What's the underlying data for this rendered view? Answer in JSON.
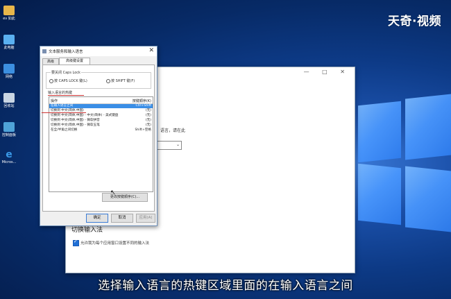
{
  "watermark": "天奇·视频",
  "caption": "选择输入语言的热键区域里面的在输入语言之间",
  "desktop_icons": [
    {
      "name": "folder",
      "label": "ev 如此"
    },
    {
      "name": "this-pc",
      "label": "此电脑"
    },
    {
      "name": "network",
      "label": "网络"
    },
    {
      "name": "recycle-bin",
      "label": "回收站"
    },
    {
      "name": "control-panel",
      "label": "控制面板"
    },
    {
      "name": "edge",
      "label": "Micros..."
    }
  ],
  "dialog": {
    "title": "文本服务和输入语言",
    "tabs": [
      "高级",
      "高级键设置"
    ],
    "group1_title": "要关闭 Caps Lock",
    "option1": "按 CAPS LOCK 键(L)",
    "option2": "按 SHIFT 键(F)",
    "group2_title": "输入语言的热键",
    "list_headers": {
      "action": "操作",
      "keys": "按键顺序(K)"
    },
    "rows": [
      {
        "action": "在输入语言之间",
        "keys": "Ctrl+Shift"
      },
      {
        "action": "切换到 中文(简体,中国)",
        "keys": "(无)"
      },
      {
        "action": "切换到 中文(简体,中国) - 中文(简体) - 美式键盘",
        "keys": "(无)"
      },
      {
        "action": "切换到 中文(简体,中国) - 微软拼音",
        "keys": "(无)"
      },
      {
        "action": "切换到 中文(简体,中国) - 微软五笔",
        "keys": "(无)"
      },
      {
        "action": "在全/半角之间切换",
        "keys": "Shift+空格"
      }
    ],
    "change_button": "更改按键顺序(C)...",
    "ok": "确定",
    "cancel": "取消",
    "apply": "应用(A)"
  },
  "settings": {
    "controls": "— □ ✕",
    "fragment": "语言，请在此",
    "section_head": "切换输入法",
    "checkbox_label": "允许我为每个应用窗口设置不同的输入法"
  },
  "colors": {
    "selection": "#3a8ee6",
    "accent_mark": "#cc3333"
  }
}
